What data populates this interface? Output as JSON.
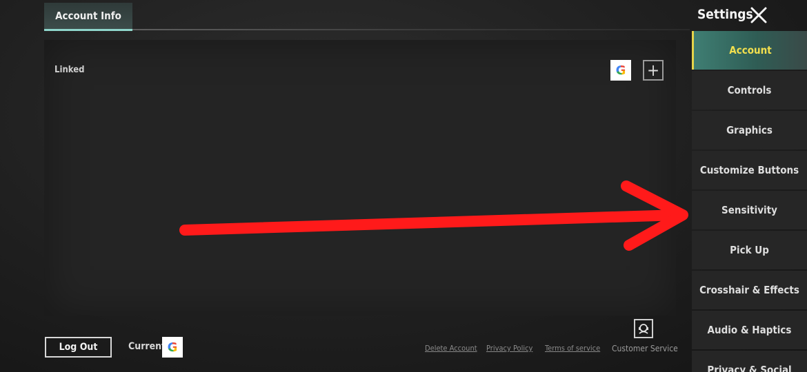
{
  "header": {
    "tab_label": "Account Info"
  },
  "settings": {
    "title": "Settings"
  },
  "linked": {
    "label": "Linked",
    "google_glyph": "G"
  },
  "sidebar": {
    "items": [
      {
        "label": "Account",
        "active": true
      },
      {
        "label": "Controls"
      },
      {
        "label": "Graphics"
      },
      {
        "label": "Customize Buttons"
      },
      {
        "label": "Sensitivity"
      },
      {
        "label": "Pick Up"
      },
      {
        "label": "Crosshair & Effects"
      },
      {
        "label": "Audio & Haptics"
      },
      {
        "label": "Privacy & Social"
      }
    ]
  },
  "footer": {
    "logout_label": "Log Out",
    "current_label": "Current",
    "google_glyph": "G",
    "links": [
      "Delete Account",
      "Privacy Policy",
      "Terms of service"
    ],
    "customer_service": "Customer Service"
  },
  "icons": {
    "close": "close-icon",
    "add": "plus-icon",
    "google": "google-icon",
    "customer_service": "headset-icon",
    "annotation": "red-arrow"
  },
  "colors": {
    "accent_active": "#f3e04e",
    "tab_underline": "#8fd6cc",
    "arrow": "#ff1a1a"
  }
}
